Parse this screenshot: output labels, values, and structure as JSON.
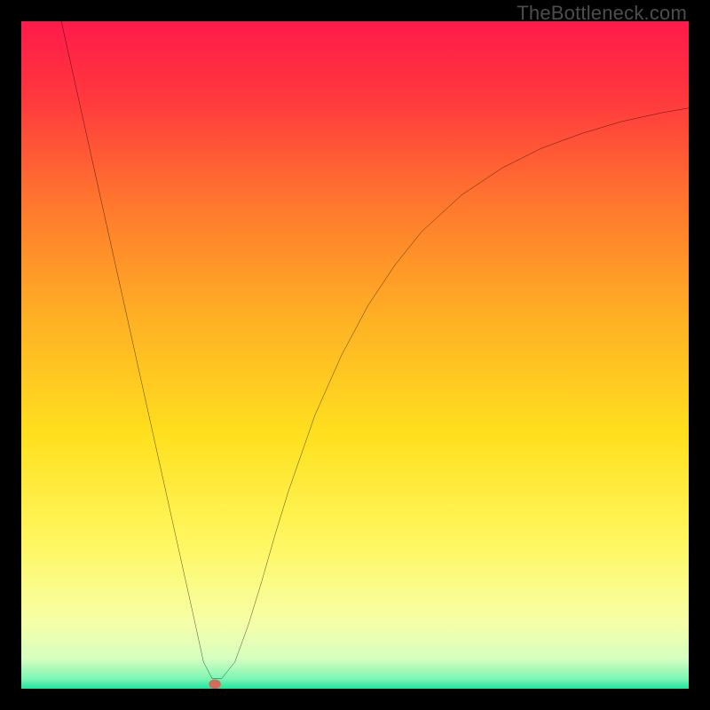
{
  "watermark": "TheBottleneck.com",
  "chart_data": {
    "type": "line",
    "title": "",
    "xlabel": "",
    "ylabel": "",
    "xlim": [
      0,
      100
    ],
    "ylim": [
      0,
      100
    ],
    "grid": false,
    "legend": false,
    "background_gradient_stops": [
      {
        "offset": 0.0,
        "color": "#ff1a4a"
      },
      {
        "offset": 0.12,
        "color": "#ff3a3d"
      },
      {
        "offset": 0.28,
        "color": "#ff7a2d"
      },
      {
        "offset": 0.45,
        "color": "#ffb224"
      },
      {
        "offset": 0.62,
        "color": "#ffe01e"
      },
      {
        "offset": 0.78,
        "color": "#fff760"
      },
      {
        "offset": 0.9,
        "color": "#f6ffa8"
      },
      {
        "offset": 0.955,
        "color": "#d6ffc0"
      },
      {
        "offset": 0.985,
        "color": "#7cf7b5"
      },
      {
        "offset": 1.0,
        "color": "#1de6a0"
      }
    ],
    "series": [
      {
        "name": "bottleneck-curve",
        "color": "#000000",
        "width": 2,
        "x": [
          6,
          8,
          10,
          12,
          14,
          16,
          18,
          20,
          22,
          24,
          26,
          27.3,
          28.6,
          30,
          32,
          34,
          36,
          38,
          40,
          44,
          48,
          52,
          56,
          60,
          66,
          72,
          78,
          84,
          90,
          96,
          100
        ],
        "y": [
          100,
          91,
          82,
          73,
          64,
          55,
          46,
          37,
          28,
          19,
          10,
          4,
          1.5,
          1.5,
          4,
          9.5,
          16,
          23,
          29.5,
          41,
          50,
          57.5,
          63.5,
          68.5,
          74,
          78,
          81,
          83.2,
          85,
          86.3,
          87
        ]
      }
    ],
    "markers": [
      {
        "name": "optimum-point",
        "x": 29,
        "y": 0.7,
        "rx": 0.9,
        "ry": 0.7,
        "fill": "#d46a5a"
      }
    ]
  }
}
